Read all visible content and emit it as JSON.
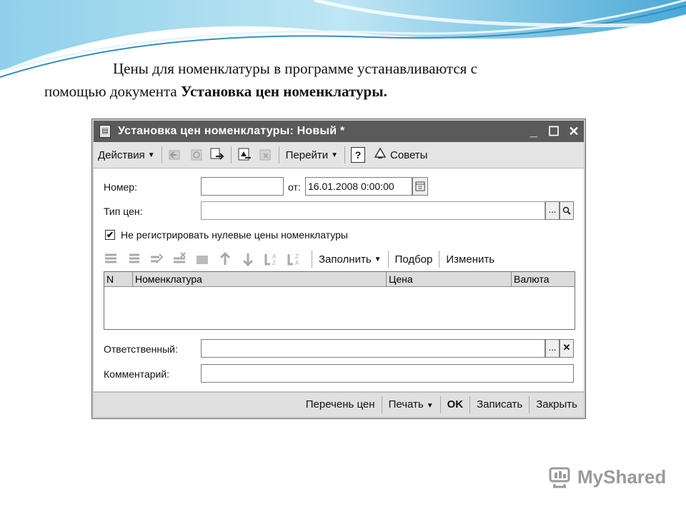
{
  "slide": {
    "line1": "Цены для номенклатуры в программе устанавливаются с",
    "line2_prefix": "помощью документа ",
    "line2_bold": "Установка цен номенклатуры."
  },
  "window": {
    "title": "Установка цен номенклатуры: Новый *",
    "controls": [
      "_",
      "☐",
      "✕"
    ]
  },
  "toolbar": {
    "actions_label": "Действия",
    "goto_label": "Перейти",
    "help_label": "?",
    "tips_label": "Советы"
  },
  "form": {
    "number_label": "Номер:",
    "number_value": "",
    "date_label": "от:",
    "date_value": "16.01.2008  0:00:00",
    "price_type_label": "Тип цен:",
    "price_type_value": "",
    "checkbox_label": "Не регистрировать нулевые цены номенклатуры",
    "checkbox_checked": true,
    "responsible_label": "Ответственный:",
    "responsible_value": "",
    "comment_label": "Комментарий:",
    "comment_value": ""
  },
  "table_toolbar": {
    "fill_label": "Заполнить",
    "select_label": "Подбор",
    "change_label": "Изменить"
  },
  "table": {
    "columns": [
      "N",
      "Номенклатура",
      "Цена",
      "Валюта"
    ]
  },
  "footer": {
    "price_list": "Перечень цен",
    "print": "Печать",
    "ok": "OK",
    "save": "Записать",
    "close": "Закрыть"
  },
  "watermark": {
    "text": "MyShared"
  }
}
